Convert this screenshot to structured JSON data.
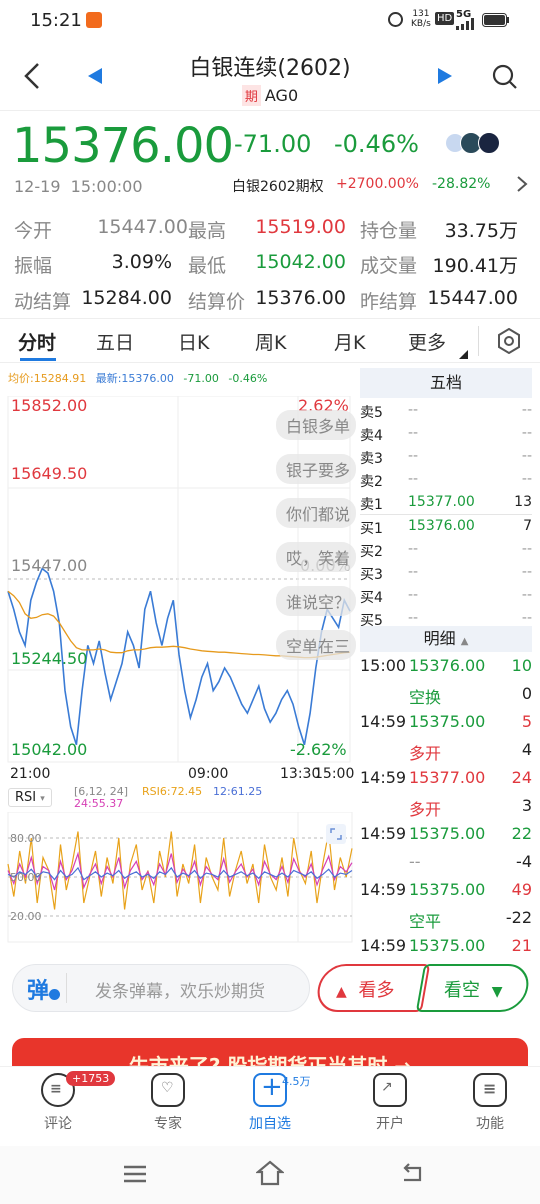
{
  "status": {
    "time": "15:21",
    "net_speed": "131",
    "net_unit": "KB/s",
    "hd": "HD",
    "sig": "5G"
  },
  "header": {
    "title": "白银连续(2602)",
    "tag": "期",
    "code": "AG0"
  },
  "quote": {
    "price": "15376.00",
    "change": "-71.00",
    "change_pct": "-0.46%",
    "datetime": "12-19  15:00:00",
    "option_label": "白银2602期权",
    "option_pct1": "+2700.00%",
    "option_pct2": "-28.82%"
  },
  "stats": [
    {
      "label": "今开",
      "value": "15447.00"
    },
    {
      "label": "最高",
      "value": "15519.00"
    },
    {
      "label": "持仓量",
      "value": "33.75万"
    },
    {
      "label": "振幅",
      "value": "3.09%"
    },
    {
      "label": "最低",
      "value": "15042.00"
    },
    {
      "label": "成交量",
      "value": "190.41万"
    },
    {
      "label": "动结算",
      "value": "15284.00"
    },
    {
      "label": "结算价",
      "value": "15376.00"
    },
    {
      "label": "昨结算",
      "value": "15447.00"
    }
  ],
  "tabs": [
    "分时",
    "五日",
    "日K",
    "周K",
    "月K",
    "更多"
  ],
  "chart": {
    "legend_avg": "均价:15284.91",
    "legend_last": "最新:15376.00",
    "legend_chg": "-71.00",
    "legend_pct": "-0.46%",
    "y_top": "15852.00",
    "y_2": "15649.50",
    "y_mid": "15447.00",
    "y_4": "15244.50",
    "y_bot": "15042.00",
    "pct_top": "2.62%",
    "pct_mid": "0.00%",
    "pct_bot": "-2.62%",
    "x_labels": [
      "21:00",
      "09:00",
      "13:30",
      "15:00"
    ],
    "indicator": "RSI",
    "rsi_params": "[6,12, 24]",
    "rsi6": "RSI6:72.45",
    "rsi12": "12:61.25",
    "rsi24": "24:55.37",
    "rsi_80": "80.00",
    "rsi_50": "50.00",
    "rsi_20": "20.00"
  },
  "chart_data": {
    "type": "line",
    "xlabel": "",
    "ylabel": "",
    "ylim": [
      15042,
      15852
    ],
    "x_ticks": [
      "21:00",
      "09:00",
      "13:30",
      "15:00"
    ],
    "series": [
      {
        "name": "最新",
        "values": [
          15420,
          15380,
          15330,
          15300,
          15400,
          15440,
          15470,
          15460,
          15420,
          15350,
          15200,
          15120,
          15080,
          15200,
          15300,
          15260,
          15310,
          15240,
          15180,
          15220,
          15260,
          15330,
          15300,
          15250,
          15380,
          15420,
          15350,
          15300,
          15360,
          15400,
          15280,
          15200,
          15140,
          15180,
          15230,
          15260,
          15200,
          15220,
          15250,
          15230,
          15200,
          15170,
          15150,
          15180,
          15210,
          15160,
          15130,
          15150,
          15180,
          15200,
          15170,
          15120,
          15080,
          15150,
          15250,
          15330,
          15380,
          15360,
          15340,
          15400,
          15376
        ]
      },
      {
        "name": "均价",
        "values": [
          15420,
          15410,
          15395,
          15370,
          15360,
          15362,
          15368,
          15370,
          15365,
          15350,
          15330,
          15310,
          15295,
          15290,
          15290,
          15290,
          15292,
          15290,
          15285,
          15284,
          15284,
          15288,
          15290,
          15290,
          15292,
          15295,
          15296,
          15296,
          15297,
          15298,
          15297,
          15295,
          15292,
          15290,
          15288,
          15287,
          15286,
          15285,
          15285,
          15284,
          15283,
          15282,
          15281,
          15280,
          15280,
          15279,
          15278,
          15277,
          15277,
          15276,
          15275,
          15274,
          15273,
          15273,
          15274,
          15276,
          15278,
          15280,
          15282,
          15284,
          15285
        ]
      }
    ],
    "secondary": {
      "name": "RSI",
      "ylim": [
        0,
        100
      ],
      "gridlines": [
        20,
        50,
        80
      ],
      "series": [
        {
          "name": "RSI6",
          "values": [
            60,
            35,
            70,
            45,
            80,
            30,
            65,
            55,
            25,
            75,
            40,
            60,
            85,
            30,
            50,
            70,
            35,
            65,
            45,
            80,
            25,
            60,
            75,
            40,
            55,
            30,
            70,
            50,
            85,
            35,
            60,
            45,
            75,
            30,
            65,
            50,
            40,
            80,
            35,
            55,
            70,
            45,
            60,
            30,
            75,
            50,
            40,
            65,
            35,
            80,
            55,
            45,
            70,
            30,
            60,
            85,
            40,
            65,
            50,
            72
          ]
        },
        {
          "name": "RSI12",
          "values": [
            55,
            45,
            60,
            50,
            65,
            45,
            58,
            55,
            40,
            62,
            48,
            55,
            68,
            42,
            52,
            60,
            45,
            58,
            50,
            65,
            42,
            55,
            62,
            48,
            54,
            44,
            60,
            52,
            68,
            46,
            56,
            50,
            62,
            44,
            58,
            52,
            48,
            64,
            46,
            54,
            60,
            50,
            56,
            44,
            62,
            52,
            48,
            58,
            46,
            64,
            54,
            50,
            60,
            44,
            56,
            66,
            48,
            58,
            54,
            61
          ]
        },
        {
          "name": "RSI24",
          "values": [
            52,
            50,
            54,
            52,
            56,
            50,
            54,
            53,
            48,
            55,
            50,
            52,
            57,
            48,
            51,
            54,
            50,
            53,
            51,
            55,
            49,
            52,
            54,
            50,
            52,
            49,
            54,
            52,
            57,
            50,
            53,
            51,
            55,
            49,
            53,
            52,
            50,
            55,
            50,
            52,
            54,
            51,
            53,
            49,
            54,
            52,
            50,
            53,
            50,
            55,
            53,
            51,
            54,
            49,
            52,
            56,
            50,
            53,
            52,
            55
          ]
        }
      ]
    }
  },
  "danmaku": [
    "白银多单",
    "银子要多",
    "你们都说",
    "哎，笑着",
    "谁说空？",
    "空单在三"
  ],
  "orderbook": {
    "title": "五档",
    "asks": [
      {
        "label": "卖5",
        "price": "--",
        "vol": "--"
      },
      {
        "label": "卖4",
        "price": "--",
        "vol": "--"
      },
      {
        "label": "卖3",
        "price": "--",
        "vol": "--"
      },
      {
        "label": "卖2",
        "price": "--",
        "vol": "--"
      },
      {
        "label": "卖1",
        "price": "15377.00",
        "vol": "13"
      }
    ],
    "bids": [
      {
        "label": "买1",
        "price": "15376.00",
        "vol": "7"
      },
      {
        "label": "买2",
        "price": "--",
        "vol": "--"
      },
      {
        "label": "买3",
        "price": "--",
        "vol": "--"
      },
      {
        "label": "买4",
        "price": "--",
        "vol": "--"
      },
      {
        "label": "买5",
        "price": "--",
        "vol": "--"
      }
    ],
    "detail_title": "明细",
    "details": [
      {
        "time": "15:00",
        "price": "15376.00",
        "vol": "10",
        "type": "空换",
        "oi": "0"
      },
      {
        "time": "14:59",
        "price": "15375.00",
        "vol": "5",
        "type": "多开",
        "oi": "4"
      },
      {
        "time": "14:59",
        "price": "15377.00",
        "vol": "24",
        "type": "多开",
        "oi": "3"
      },
      {
        "time": "14:59",
        "price": "15375.00",
        "vol": "22",
        "type": "--",
        "oi": "-4"
      },
      {
        "time": "14:59",
        "price": "15375.00",
        "vol": "49",
        "type": "空平",
        "oi": "-22"
      },
      {
        "time": "14:59",
        "price": "15375.00",
        "vol": "21",
        "type": "",
        "oi": ""
      }
    ]
  },
  "action": {
    "dm_icon": "弹",
    "input_placeholder": "发条弹幕，欢乐炒期货",
    "bull": "看多",
    "bear": "看空"
  },
  "banner_text": "牛市来了? 股指期货正当其时 →",
  "bottom": [
    {
      "label": "评论",
      "badge": "+1753"
    },
    {
      "label": "专家"
    },
    {
      "label": "加自选",
      "badge": "4.5万"
    },
    {
      "label": "开户"
    },
    {
      "label": "功能"
    }
  ],
  "colors": {
    "up": "#e0383e",
    "down": "#1a9b3c",
    "avg": "#e69a1c",
    "price": "#3a7bd5",
    "rsi6": "#e8a21a",
    "rsi12": "#d63fb5",
    "rsi24": "#4a6fd6",
    "accent": "#1f7ae0"
  }
}
